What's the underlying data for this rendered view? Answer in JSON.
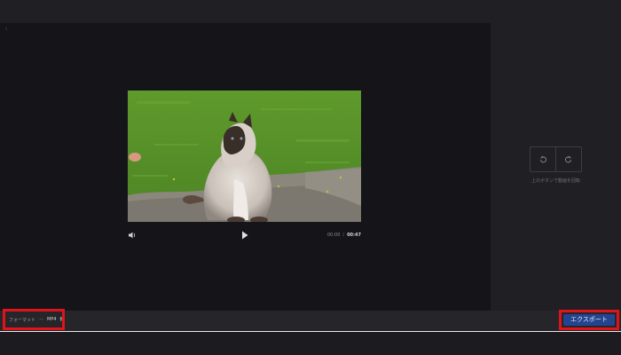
{
  "player": {
    "current_time": "00:00",
    "separator": "/",
    "total_time": "00:47",
    "icons": {
      "back": "chevron-left-icon",
      "volume": "volume-icon",
      "play": "play-icon"
    }
  },
  "rotate": {
    "caption": "上のボタンで動画を回転",
    "icons": [
      "rotate-left-icon",
      "rotate-right-icon"
    ]
  },
  "bottom_bar": {
    "format_label": "フォーマット",
    "format_separator": "—",
    "format_value": "MP4",
    "export_label": "エクスポート"
  },
  "colors": {
    "accent": "#23448f",
    "highlight": "#e0131b",
    "preview_bg": "#151519",
    "app_bg": "#202024"
  }
}
